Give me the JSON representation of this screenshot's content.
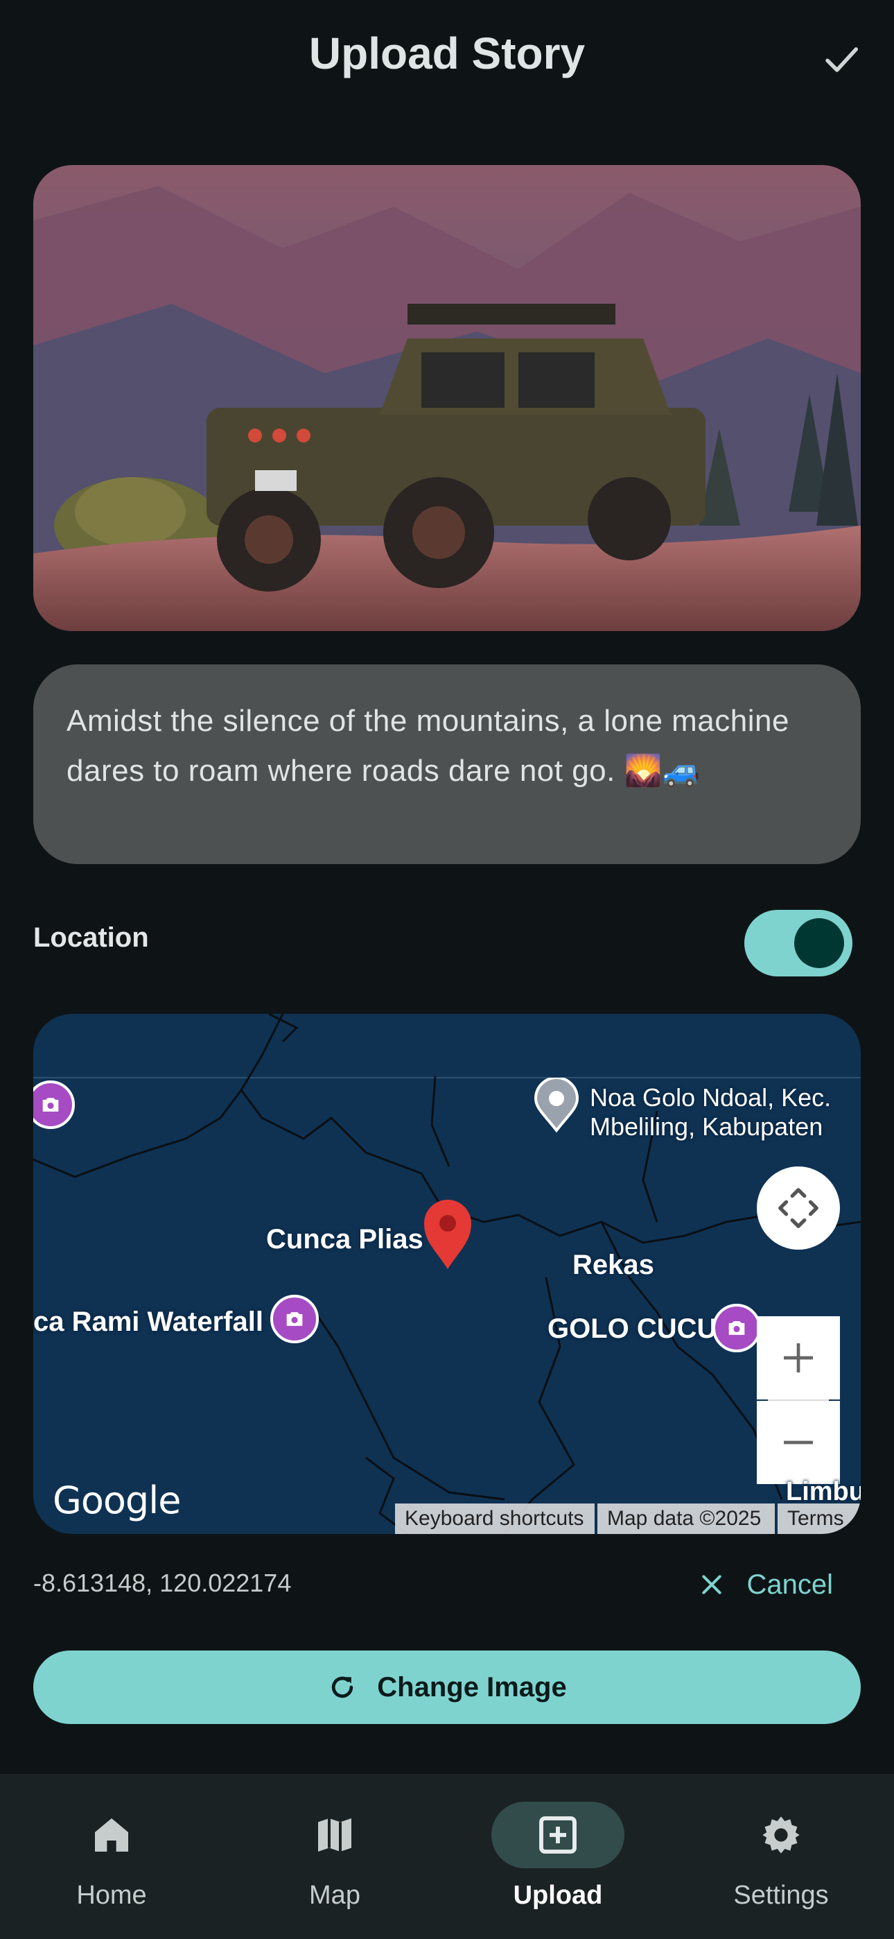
{
  "header": {
    "title": "Upload Story",
    "confirm_icon": "check-icon"
  },
  "story": {
    "caption": "Amidst the silence of the mountains, a lone machine dares to roam where roads dare not go. 🌄🚙"
  },
  "location": {
    "label": "Location",
    "enabled": true,
    "coordinates": "-8.613148, 120.022174",
    "cancel_label": "Cancel"
  },
  "map": {
    "places": {
      "noa_line1": "Noa Golo Ndoal, Kec.",
      "noa_line2": "Mbeliling, Kabupaten",
      "cunca_plias": "Cunca Plias",
      "rekas": "Rekas",
      "rami": "ca Rami Waterfall",
      "golo_cucu": "GOLO CUCU",
      "limbu": "Limbu"
    },
    "logo": "Google",
    "attribution": {
      "shortcuts": "Keyboard shortcuts",
      "data": "Map data ©2025",
      "terms": "Terms"
    }
  },
  "actions": {
    "change_image": "Change Image"
  },
  "nav": {
    "items": [
      {
        "label": "Home",
        "icon": "home-icon",
        "active": false
      },
      {
        "label": "Map",
        "icon": "map-icon",
        "active": false
      },
      {
        "label": "Upload",
        "icon": "add-box-icon",
        "active": true
      },
      {
        "label": "Settings",
        "icon": "gear-icon",
        "active": false
      }
    ]
  },
  "colors": {
    "background": "#0e1416",
    "accent": "#7fd3cf",
    "caption_bg": "#4e5152",
    "map_bg": "#0f3253"
  }
}
